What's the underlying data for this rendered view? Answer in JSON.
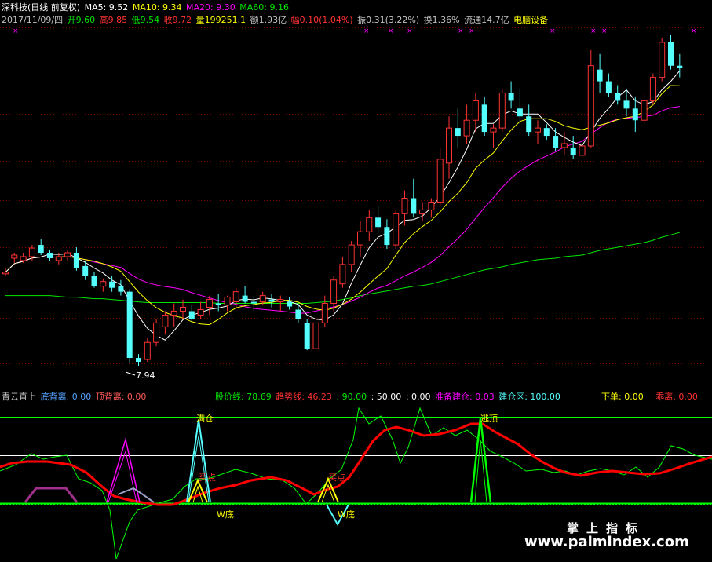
{
  "colors": {
    "bg": "#000000",
    "up": "#ff3232",
    "down": "#54ffff",
    "ma5": "#ffffff",
    "ma10": "#ffff00",
    "ma20": "#ff00ff",
    "ma60": "#00e600",
    "grid": "#800000",
    "indicator_red": "#ff0000",
    "indicator_green": "#00ff00",
    "yellow": "#ffff00"
  },
  "header": {
    "symbol": "深科技(日线 前复权)",
    "ma5": "MA5: 9.52",
    "ma10": "MA10: 9.34",
    "ma20": "MA20: 9.30",
    "ma60": "MA60: 9.16",
    "date": "2017/11/09/四",
    "open": "开9.60",
    "high": "高9.85",
    "low": "低9.54",
    "close": "收9.72",
    "volume": "量199251.1",
    "amount": "额1.93亿",
    "change": "幅0.10(1.04%)",
    "amplitude": "振0.31(3.22%)",
    "turnover": "换1.36%",
    "float": "流通14.7亿",
    "sector": "电脑设备"
  },
  "main_chart": {
    "low_label": "7.94",
    "markers": [
      "×",
      "×",
      "×",
      "×",
      "×",
      "×",
      "×",
      "×",
      "×",
      "×"
    ]
  },
  "indicator_header": {
    "name": "青云直上",
    "bottom_div": "底背离: 0.00",
    "top_div": "顶背离: 0.00",
    "price_line": "股价线: 78.69",
    "trend_line": "趋势线: 46.23",
    "v90": ": 90.00",
    "v50": ": 50.00",
    "v0": ": 0.00",
    "prepare": "准备建仓: 0.03",
    "build": "建仓区: 100.00",
    "order": "下单: 0.00",
    "deviation": "乖离: 0.00"
  },
  "indicator_labels": {
    "full": "满仓",
    "buy1": "买点",
    "buy2": "买点",
    "w1": "W底",
    "w2": "W底",
    "top": "逃顶"
  },
  "watermark": {
    "cn": "掌上指标",
    "url": "www.palmindex.com"
  },
  "candles": [
    [
      9.08,
      9.15,
      9.05,
      9.1
    ],
    [
      9.28,
      9.35,
      9.22,
      9.32
    ],
    [
      9.25,
      9.35,
      9.22,
      9.3
    ],
    [
      9.3,
      9.45,
      9.25,
      9.41
    ],
    [
      9.45,
      9.52,
      9.32,
      9.35
    ],
    [
      9.35,
      9.38,
      9.25,
      9.28
    ],
    [
      9.25,
      9.35,
      9.2,
      9.3
    ],
    [
      9.3,
      9.38,
      9.25,
      9.35
    ],
    [
      9.35,
      9.42,
      9.12,
      9.15
    ],
    [
      9.18,
      9.25,
      9.0,
      9.05
    ],
    [
      9.05,
      9.1,
      8.9,
      8.92
    ],
    [
      8.92,
      9.02,
      8.85,
      8.98
    ],
    [
      8.98,
      9.05,
      8.85,
      8.9
    ],
    [
      8.92,
      9.0,
      8.8,
      8.85
    ],
    [
      8.85,
      8.88,
      7.94,
      8.0
    ],
    [
      8.0,
      8.05,
      7.9,
      7.95
    ],
    [
      7.98,
      8.25,
      7.95,
      8.2
    ],
    [
      8.2,
      8.5,
      8.15,
      8.45
    ],
    [
      8.4,
      8.6,
      8.3,
      8.55
    ],
    [
      8.55,
      8.7,
      8.4,
      8.6
    ],
    [
      8.6,
      8.75,
      8.5,
      8.65
    ],
    [
      8.6,
      8.68,
      8.45,
      8.5
    ],
    [
      8.55,
      8.72,
      8.5,
      8.62
    ],
    [
      8.65,
      8.8,
      8.55,
      8.75
    ],
    [
      8.7,
      8.82,
      8.6,
      8.68
    ],
    [
      8.68,
      8.8,
      8.6,
      8.78
    ],
    [
      8.72,
      8.9,
      8.65,
      8.85
    ],
    [
      8.8,
      8.92,
      8.7,
      8.72
    ],
    [
      8.72,
      8.8,
      8.6,
      8.7
    ],
    [
      8.72,
      8.85,
      8.68,
      8.8
    ],
    [
      8.75,
      8.82,
      8.65,
      8.72
    ],
    [
      8.72,
      8.8,
      8.6,
      8.75
    ],
    [
      8.72,
      8.78,
      8.62,
      8.66
    ],
    [
      8.62,
      8.7,
      8.45,
      8.5
    ],
    [
      8.45,
      8.5,
      8.1,
      8.12
    ],
    [
      8.12,
      8.5,
      8.05,
      8.45
    ],
    [
      8.45,
      8.8,
      8.4,
      8.7
    ],
    [
      8.7,
      9.05,
      8.6,
      9.0
    ],
    [
      8.95,
      9.3,
      8.9,
      9.2
    ],
    [
      9.2,
      9.5,
      9.1,
      9.45
    ],
    [
      9.45,
      9.75,
      9.3,
      9.62
    ],
    [
      9.62,
      9.9,
      9.5,
      9.8
    ],
    [
      9.8,
      9.95,
      9.6,
      9.68
    ],
    [
      9.68,
      9.78,
      9.4,
      9.45
    ],
    [
      9.45,
      9.9,
      9.4,
      9.85
    ],
    [
      9.85,
      10.15,
      9.7,
      10.05
    ],
    [
      10.05,
      10.3,
      9.8,
      9.85
    ],
    [
      9.85,
      10.0,
      9.75,
      9.9
    ],
    [
      9.9,
      10.05,
      9.8,
      10.0
    ],
    [
      10.0,
      10.7,
      9.95,
      10.55
    ],
    [
      10.5,
      11.1,
      10.3,
      10.95
    ],
    [
      10.95,
      11.2,
      10.7,
      10.85
    ],
    [
      10.85,
      11.25,
      10.75,
      11.05
    ],
    [
      11.05,
      11.4,
      10.9,
      11.3
    ],
    [
      11.25,
      11.35,
      10.85,
      10.9
    ],
    [
      10.9,
      11.0,
      10.7,
      10.95
    ],
    [
      10.95,
      11.45,
      10.9,
      11.4
    ],
    [
      11.4,
      11.55,
      11.2,
      11.3
    ],
    [
      11.2,
      11.45,
      11.0,
      11.1
    ],
    [
      11.1,
      11.25,
      10.85,
      10.9
    ],
    [
      10.9,
      11.05,
      10.75,
      10.95
    ],
    [
      10.95,
      11.0,
      10.8,
      10.85
    ],
    [
      10.85,
      10.95,
      10.65,
      10.7
    ],
    [
      10.7,
      10.9,
      10.6,
      10.75
    ],
    [
      10.7,
      10.85,
      10.55,
      10.6
    ],
    [
      10.6,
      10.8,
      10.5,
      10.72
    ],
    [
      10.72,
      11.95,
      10.7,
      11.75
    ],
    [
      11.7,
      11.9,
      11.4,
      11.55
    ],
    [
      11.55,
      11.65,
      11.35,
      11.4
    ],
    [
      11.4,
      11.5,
      11.25,
      11.3
    ],
    [
      11.3,
      11.45,
      11.1,
      11.2
    ],
    [
      11.2,
      11.35,
      10.9,
      11.05
    ],
    [
      11.05,
      11.4,
      11.0,
      11.3
    ],
    [
      11.3,
      11.65,
      11.25,
      11.6
    ],
    [
      11.6,
      12.1,
      11.55,
      12.05
    ],
    [
      12.05,
      12.15,
      11.7,
      11.75
    ],
    [
      11.75,
      11.9,
      11.6,
      11.72
    ]
  ],
  "ma60": [
    8.8,
    8.8,
    8.8,
    8.8,
    8.8,
    8.8,
    8.79,
    8.78,
    8.78,
    8.77,
    8.76,
    8.76,
    8.75,
    8.74,
    8.73,
    8.72,
    8.71,
    8.71,
    8.71,
    8.71,
    8.71,
    8.71,
    8.71,
    8.71,
    8.7,
    8.7,
    8.7,
    8.7,
    8.7,
    8.7,
    8.7,
    8.7,
    8.7,
    8.7,
    8.7,
    8.71,
    8.72,
    8.73,
    8.75,
    8.77,
    8.8,
    8.82,
    8.84,
    8.86,
    8.88,
    8.9,
    8.92,
    8.93,
    8.95,
    8.98,
    9.01,
    9.04,
    9.07,
    9.1,
    9.13,
    9.15,
    9.17,
    9.2,
    9.22,
    9.24,
    9.26,
    9.27,
    9.28,
    9.3,
    9.31,
    9.32,
    9.35,
    9.38,
    9.4,
    9.42,
    9.44,
    9.46,
    9.48,
    9.51,
    9.55,
    9.58,
    9.61
  ]
}
